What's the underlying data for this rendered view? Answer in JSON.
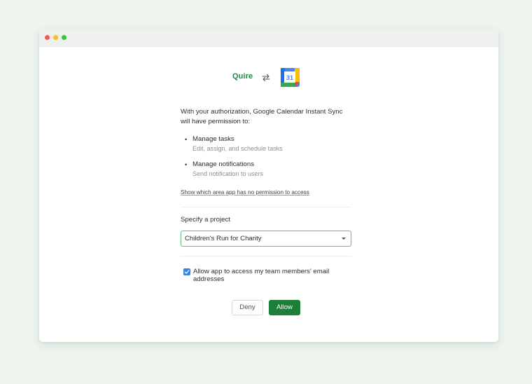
{
  "window": {
    "controls": [
      "close",
      "minimize",
      "zoom"
    ]
  },
  "header": {
    "app_logo_text": "Quire",
    "swap_icon": "swap-arrows-icon",
    "integration_icon": "google-calendar-icon",
    "calendar_day": "31"
  },
  "intro": {
    "text": "With your authorization, Google Calendar Instant Sync will have permission to:"
  },
  "permissions": [
    {
      "title": "Manage tasks",
      "description": "Edit, assign, and schedule tasks"
    },
    {
      "title": "Manage notifications",
      "description": "Send notification to users"
    }
  ],
  "no_permission_link": "Show which area app has no permission to access",
  "project": {
    "label": "Specify a project",
    "selected": "Children's Run for Charity"
  },
  "email_access": {
    "checked": true,
    "label": "Allow app to access my team members' email addresses"
  },
  "actions": {
    "deny_label": "Deny",
    "allow_label": "Allow"
  },
  "colors": {
    "brand_green": "#1b7f37",
    "accent_blue": "#3b82e6",
    "background": "#eef5ee"
  }
}
